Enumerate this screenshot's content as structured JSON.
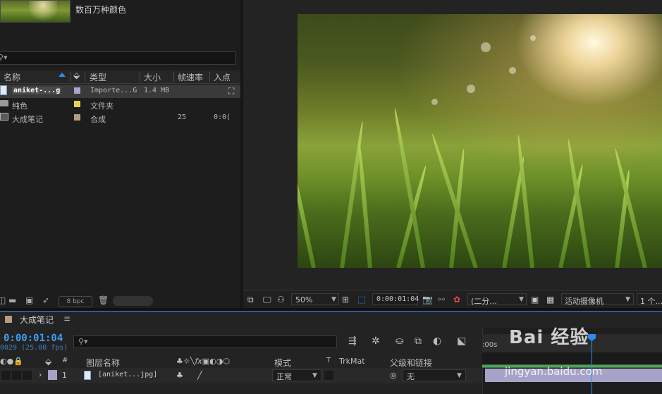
{
  "project": {
    "color_info": "数百万种颜色",
    "columns": [
      "名称",
      "类型",
      "大小",
      "帧速率",
      "入点"
    ],
    "items": [
      {
        "name": "aniket-...g",
        "type": "Importe...G",
        "size": "1.4 MB",
        "fps": "",
        "in": "",
        "label_color": "#a8a4d4",
        "icon": "image-file-icon"
      },
      {
        "name": "纯色",
        "type": "文件夹",
        "size": "",
        "fps": "",
        "in": "",
        "label_color": "#e6d24a",
        "icon": "folder-icon"
      },
      {
        "name": "大成笔记",
        "type": "合成",
        "size": "",
        "fps": "25",
        "in": "0:0(",
        "label_color": "#b39c82",
        "icon": "composition-icon"
      }
    ],
    "bpc": "8 bpc"
  },
  "viewer": {
    "zoom": "50%",
    "timecode": "0:00:01:04",
    "resolution": "(二分...",
    "camera": "活动摄像机",
    "views": "1 个..."
  },
  "timeline": {
    "comp_name": "大成笔记",
    "menu": "≡",
    "timecode": "0:00:01:04",
    "frames_fps": "0029 (25.00 fps)",
    "headers": {
      "num": "#",
      "layer_name": "图层名称",
      "mode": "模式",
      "t": "T",
      "trkmat": "TrkMat",
      "parent": "父级和链接"
    },
    "layer": {
      "index": "1",
      "name": "[aniket...jpg]",
      "mode": "正常",
      "parent": "无",
      "label_color": "#a6a3c9"
    },
    "ruler_label": ":00s"
  },
  "watermark": {
    "brand": "Bai 经验",
    "url": "jingyan.baidu.com"
  },
  "colors": {
    "accent": "#2d8ceb",
    "timecode": "#3f9cf5",
    "layer_bar": "#a6a3c9",
    "work_area": "#39b04a"
  }
}
